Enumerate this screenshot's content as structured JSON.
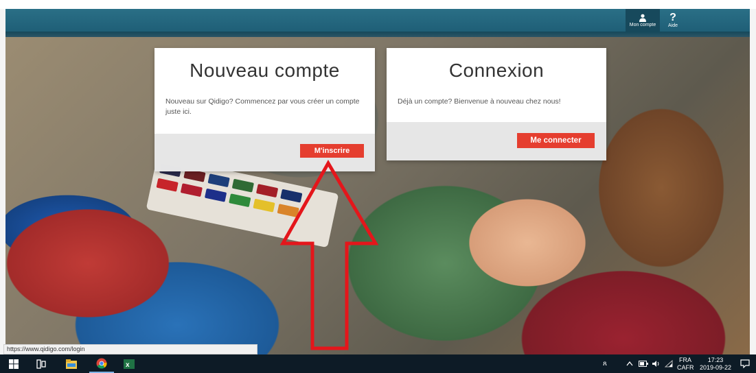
{
  "header": {
    "account_label": "Mon compte",
    "help_label": "Aide",
    "account_icon": "person-icon",
    "help_icon": "question-icon",
    "brand_color": "#1f5f77"
  },
  "new_account": {
    "title": "Nouveau compte",
    "text": "Nouveau sur Qidigo? Commencez par vous créer un compte juste ici.",
    "button": "M'inscrire"
  },
  "login": {
    "title": "Connexion",
    "text": "Déjà un compte? Bienvenue à nouveau chez nous!",
    "button": "Me connecter"
  },
  "accent_color": "#e53e2f",
  "annotation": {
    "type": "arrow",
    "color": "#e4161b",
    "points_to": "M'inscrire"
  },
  "status_bar": {
    "url": "https://www.qidigo.com/login"
  },
  "taskbar": {
    "icons": [
      "windows-start-icon",
      "task-view-icon",
      "file-explorer-icon",
      "chrome-icon",
      "excel-icon"
    ],
    "language": "FRA",
    "keyboard": "CAFR",
    "time": "17:23",
    "date": "2019-09-22"
  }
}
